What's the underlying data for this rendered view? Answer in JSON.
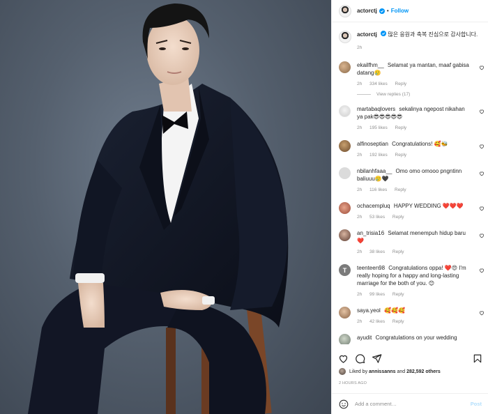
{
  "post": {
    "username": "actorctj",
    "follow_label": "Follow",
    "dot": "•",
    "caption_text": "많은 응원과 축복 진심으로 감사합니다.",
    "caption_time": "2h"
  },
  "comments": [
    {
      "user": "ekailfhm__",
      "text": "Selamat ya mantan, maaf gabisa datang🥲",
      "time": "2h",
      "likes": "334 likes",
      "reply": "Reply",
      "view_replies": "View replies (17)"
    },
    {
      "user": "martabaqlovers",
      "text": "sekalinya ngepost nikahan ya pak😎😎😎😎😎",
      "time": "2h",
      "likes": "195 likes",
      "reply": "Reply"
    },
    {
      "user": "alfinoseptian",
      "text": "Congratulations! 🥰🐝",
      "time": "2h",
      "likes": "192 likes",
      "reply": "Reply"
    },
    {
      "user": "nbilanhfaaa__",
      "text": "Omo omo omooo pngntinn baliuuu🥲🖤",
      "time": "2h",
      "likes": "116 likes",
      "reply": "Reply"
    },
    {
      "user": "ochacempluq",
      "text": "HAPPY WEDDING ❤️❤️❤️",
      "time": "2h",
      "likes": "53 likes",
      "reply": "Reply"
    },
    {
      "user": "an_trisia16",
      "text": "Selamat menempuh hidup baru ❤️",
      "time": "2h",
      "likes": "38 likes",
      "reply": "Reply"
    },
    {
      "user": "teenteen98",
      "text": "Congratulations oppa! ❤️😍 I'm really hoping for a happy and long-lasting marriage for the both of you. 😊",
      "time": "2h",
      "likes": "99 likes",
      "reply": "Reply",
      "avatar_letter": "T"
    },
    {
      "user": "saya.yeol",
      "text": "🥰🥰🥰",
      "time": "2h",
      "likes": "42 likes",
      "reply": "Reply"
    },
    {
      "user": "ayudit",
      "text": "Congratulations on your wedding",
      "time": "",
      "likes": "",
      "reply": ""
    }
  ],
  "likes_line": {
    "prefix": "Liked by",
    "user": "annissanns",
    "conjunction": "and",
    "count": "282,592 others"
  },
  "time_ago": "2 HOURS AGO",
  "add_comment": {
    "placeholder": "Add a comment…",
    "post_label": "Post"
  },
  "colors": {
    "accent": "#0095f6",
    "post_disabled": "#b2dffc",
    "muted": "#8e8e8e",
    "background": "#6b7785"
  },
  "icons": [
    "verified-badge-icon",
    "heart-icon",
    "comment-icon",
    "share-icon",
    "bookmark-icon",
    "emoji-icon"
  ]
}
